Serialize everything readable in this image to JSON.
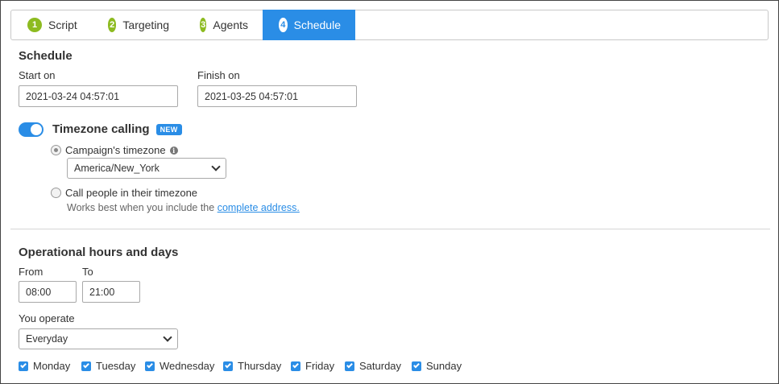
{
  "tabs": [
    {
      "num": "1",
      "label": "Script"
    },
    {
      "num": "2",
      "label": "Targeting"
    },
    {
      "num": "3",
      "label": "Agents"
    },
    {
      "num": "4",
      "label": "Schedule"
    }
  ],
  "schedule": {
    "heading": "Schedule",
    "start_label": "Start on",
    "start_value": "2021-03-24 04:57:01",
    "finish_label": "Finish on",
    "finish_value": "2021-03-25 04:57:01"
  },
  "timezone": {
    "label": "Timezone calling",
    "badge": "NEW",
    "option_campaign": "Campaign's timezone",
    "timezone_value": "America/New_York",
    "option_people": "Call people in their timezone",
    "hint_text": "Works best when you include the",
    "hint_link": "complete address."
  },
  "operational": {
    "heading": "Operational hours and days",
    "from_label": "From",
    "from_value": "08:00",
    "to_label": "To",
    "to_value": "21:00",
    "operate_label": "You operate",
    "operate_value": "Everyday"
  },
  "days": [
    "Monday",
    "Tuesday",
    "Wednesday",
    "Thursday",
    "Friday",
    "Saturday",
    "Sunday"
  ],
  "colors": {
    "accent": "#2a8de6",
    "step_green": "#8dbb20"
  }
}
